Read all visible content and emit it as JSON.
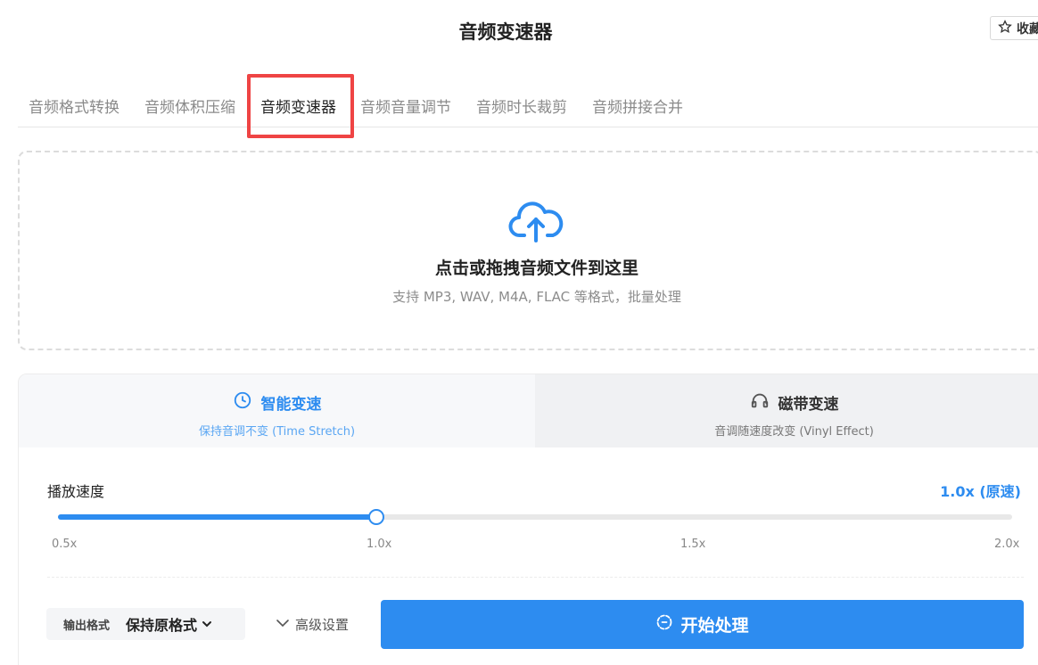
{
  "header": {
    "title": "音频变速器",
    "favorite_label": "收藏",
    "favorite_icon": "star-icon"
  },
  "tabs": [
    {
      "label": "音频格式转换",
      "active": false
    },
    {
      "label": "音频体积压缩",
      "active": false
    },
    {
      "label": "音频变速器",
      "active": true
    },
    {
      "label": "音频音量调节",
      "active": false
    },
    {
      "label": "音频时长裁剪",
      "active": false
    },
    {
      "label": "音频拼接合并",
      "active": false
    }
  ],
  "upload": {
    "icon": "cloud-upload-icon",
    "title": "点击或拖拽音频文件到这里",
    "subtitle": "支持 MP3, WAV, M4A, FLAC 等格式，批量处理"
  },
  "modes": [
    {
      "title": "智能变速",
      "subtitle": "保持音调不变 (Time Stretch)",
      "icon": "clock-icon",
      "active": true
    },
    {
      "title": "磁带变速",
      "subtitle": "音调随速度改变 (Vinyl Effect)",
      "icon": "headphones-icon",
      "active": false
    }
  ],
  "speed": {
    "label": "播放速度",
    "value_text": "1.0x (原速)",
    "value": 1.0,
    "min": 0.5,
    "max": 2.0,
    "ticks": [
      "0.5x",
      "1.0x",
      "1.5x",
      "2.0x"
    ]
  },
  "output": {
    "label": "输出格式",
    "value": "保持原格式"
  },
  "advanced_label": "高级设置",
  "start_label": "开始处理",
  "colors": {
    "accent": "#2d8cf0",
    "highlight": "#ef4444"
  }
}
